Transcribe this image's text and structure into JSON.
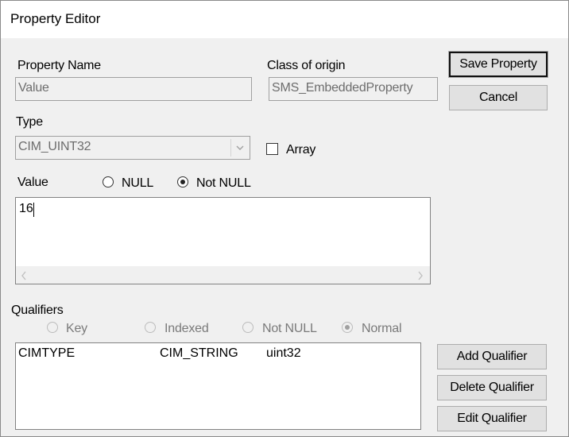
{
  "window": {
    "title": "Property Editor"
  },
  "property_name": {
    "label": "Property Name",
    "value": "Value"
  },
  "class_of_origin": {
    "label": "Class of origin",
    "value": "SMS_EmbeddedProperty"
  },
  "type": {
    "label": "Type",
    "value": "CIM_UINT32"
  },
  "array": {
    "label": "Array",
    "checked": false
  },
  "value_section": {
    "label": "Value",
    "null_label": "NULL",
    "not_null_label": "Not NULL",
    "selected": "Not NULL",
    "content": "16"
  },
  "buttons": {
    "save": "Save Property",
    "cancel": "Cancel",
    "add_qualifier": "Add Qualifier",
    "delete_qualifier": "Delete Qualifier",
    "edit_qualifier": "Edit Qualifier"
  },
  "qualifiers": {
    "label": "Qualifiers",
    "options": [
      "Key",
      "Indexed",
      "Not NULL",
      "Normal"
    ],
    "selected": "Normal",
    "rows": [
      {
        "name": "CIMTYPE",
        "type": "CIM_STRING",
        "value": "uint32"
      }
    ]
  },
  "icons": {
    "combo_arrow": "chevron-down-icon",
    "scroll_left": "chevron-left-icon",
    "scroll_right": "chevron-right-icon"
  }
}
